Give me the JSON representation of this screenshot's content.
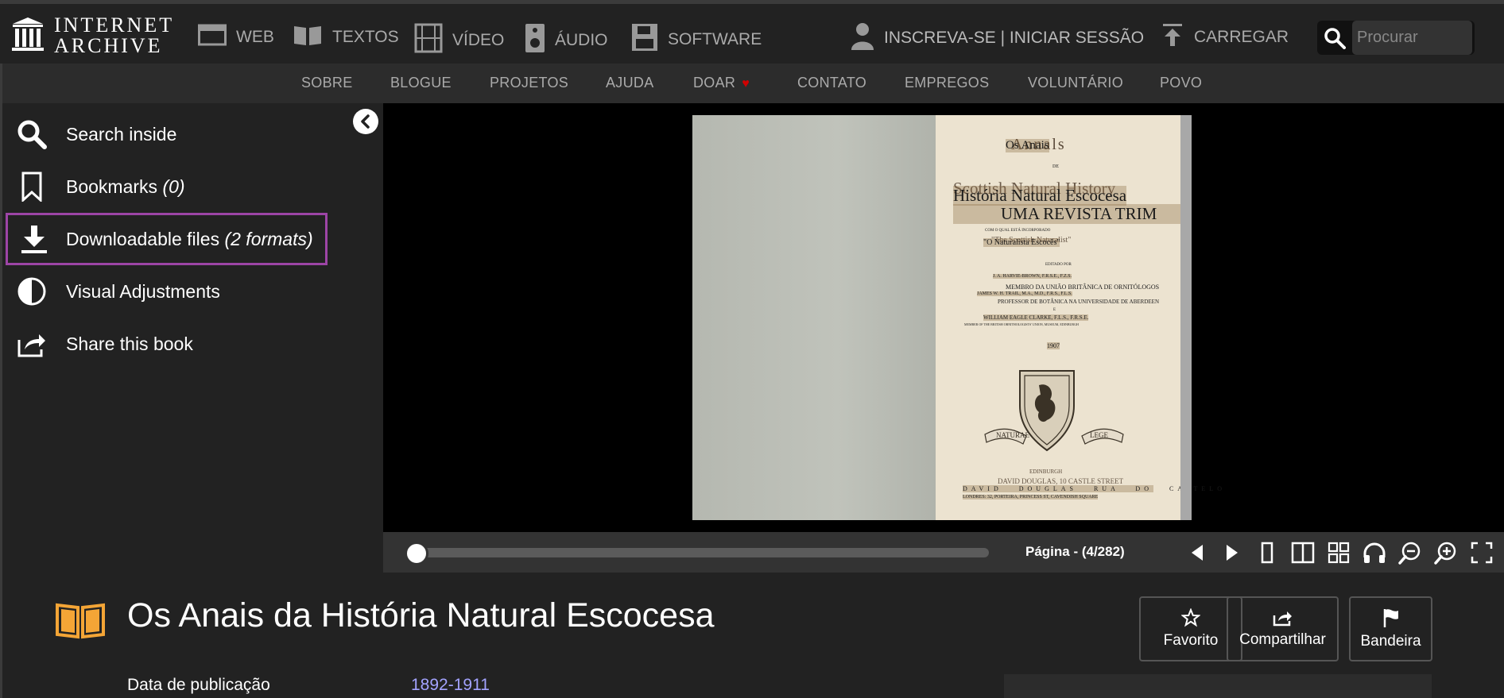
{
  "header": {
    "logo_line1": "INTERNET",
    "logo_line2": "ARCHIVE",
    "media_types": [
      {
        "label": "WEB",
        "icon": "web-icon"
      },
      {
        "label": "TEXTOS",
        "icon": "book-open-icon"
      },
      {
        "label": "VÍDEO",
        "icon": "film-icon"
      },
      {
        "label": "ÁUDIO",
        "icon": "speaker-icon"
      },
      {
        "label": "SOFTWARE",
        "icon": "floppy-disk-icon"
      }
    ],
    "user_label": "INSCREVA-SE | INICIAR SESSÃO",
    "upload_label": "CARREGAR",
    "search_placeholder": "Procurar"
  },
  "subnav": {
    "items": [
      "SOBRE",
      "BLOGUE",
      "PROJETOS",
      "AJUDA",
      "DOAR",
      "CONTATO",
      "EMPREGOS",
      "VOLUNTÁRIO",
      "POVO"
    ]
  },
  "sidebar": {
    "items": [
      {
        "label": "Search inside",
        "extra": "",
        "icon": "search-icon"
      },
      {
        "label": "Bookmarks",
        "extra": "(0)",
        "icon": "bookmark-icon"
      },
      {
        "label": "Downloadable files",
        "extra": "(2 formats)",
        "icon": "download-icon",
        "selected": true
      },
      {
        "label": "Visual Adjustments",
        "extra": "",
        "icon": "contrast-icon"
      },
      {
        "label": "Share this book",
        "extra": "",
        "icon": "share-icon"
      }
    ]
  },
  "book_page": {
    "original_title_1": "Annals",
    "translated_title_1": "Os Anais",
    "small_de": "DE",
    "original_title_2": "Scottish Natural History",
    "translated_title_2": "História Natural Escocesa",
    "subtitle": "UMA REVISTA TRIM",
    "incorporated": "COM O QUAL ESTÁ INCORPORADO",
    "original_naturalist": "\"The Scottish Naturalist\"",
    "translated_naturalist": "\"O Naturalista Escocês\"",
    "edited_by": "EDITADO POR",
    "editor_1": "J. A. HARVIE-BROWN, F.R.S.E., F.Z.S.",
    "editor_1_role": "MEMBRO DA UNIÃO BRITÂNICA DE ORNITÓLOGOS",
    "editor_2": "JAMES W. H. TRAIL, M.A., M.D., F.R.S., F.L.S.",
    "editor_2_role": "PROFESSOR DE BOTÂNICA NA UNIVERSIDADE DE ABERDEEN",
    "and": "E",
    "editor_3": "WILLIAM EAGLE CLARKE, F.L.S., F.R.S.E.",
    "editor_3_role": "MEMBER OF THE BRITISH ORNITHOLOGISTS' UNION, MUSEUM, EDINBURGH",
    "year": "1907",
    "motto_left": "NATURAE",
    "motto_right": "LEGE",
    "city": "EDINBURGH",
    "publisher": "DAVID DOUGLAS, 10 CASTLE STREET",
    "publisher_translated": "DAVID DOUGLAS RUA DO CASTELO",
    "london": "LONDRES: 32, PORTEIRA, PRINCESS ST, CAVENDISH SQUARE"
  },
  "controls": {
    "page_indicator": "Página - (4/282)",
    "progress_fraction": 0.0142,
    "buttons": [
      "prev-page-icon",
      "next-page-icon",
      "one-page-view-icon",
      "two-page-view-icon",
      "thumbnail-view-icon",
      "read-aloud-icon",
      "zoom-out-icon",
      "zoom-in-icon",
      "fullscreen-icon"
    ]
  },
  "item": {
    "title": "Os Anais da História Natural Escocesa",
    "actions": [
      {
        "label": "Favorito",
        "icon": "star-icon"
      },
      {
        "label": "Compartilhar",
        "icon": "share-icon"
      },
      {
        "label": "Bandeira",
        "icon": "flag-icon"
      }
    ],
    "meta_key": "Data de publicação",
    "meta_value": "1892-1911"
  },
  "colors": {
    "accent_purple": "#9d45a6",
    "book_icon_orange": "#f4a536",
    "link_blue": "#a3a3ff",
    "heart_red": "#d10000"
  }
}
